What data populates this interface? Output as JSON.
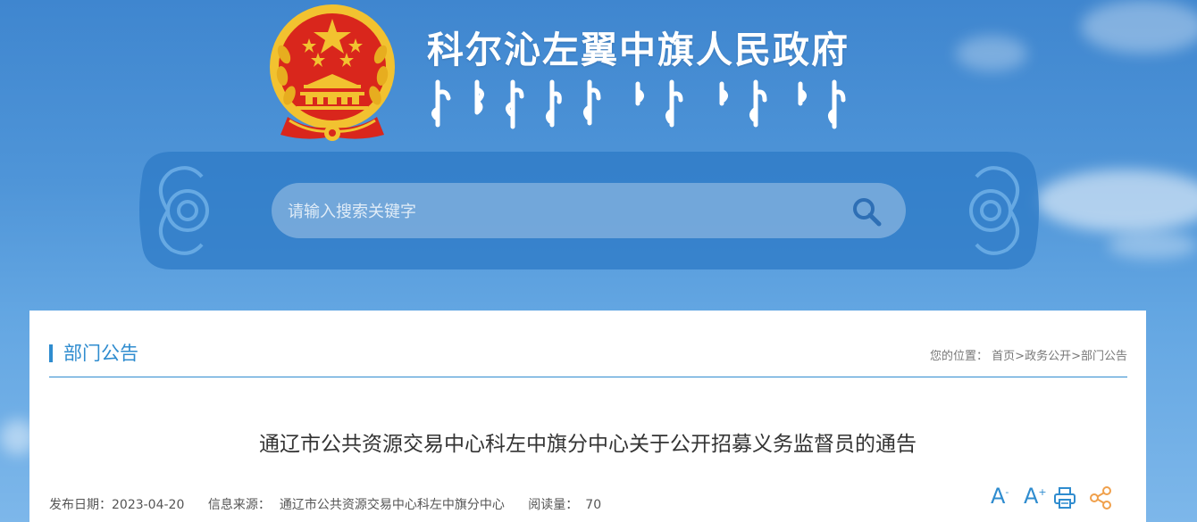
{
  "header": {
    "title": "科尔沁左翼中旗人民政府"
  },
  "search": {
    "placeholder": "请输入搜索关键字"
  },
  "section": {
    "title": "部门公告",
    "breadcrumb_label": "您的位置：",
    "breadcrumb": [
      "首页",
      "政务公开",
      "部门公告"
    ],
    "separator": ">"
  },
  "article": {
    "title": "通辽市公共资源交易中心科左中旗分中心关于公开招募义务监督员的通告",
    "date_label": "发布日期：",
    "date": "2023-04-20",
    "source_label": "信息来源：",
    "source": "通辽市公共资源交易中心科左中旗分中心",
    "views_label": "阅读量：",
    "views": "70"
  },
  "tools": {
    "font_smaller": "A",
    "font_smaller_mark": "-",
    "font_larger": "A",
    "font_larger_mark": "+"
  },
  "colors": {
    "accent": "#2f8ccf",
    "emblem_red": "#d9261c",
    "emblem_gold": "#f2c230"
  }
}
